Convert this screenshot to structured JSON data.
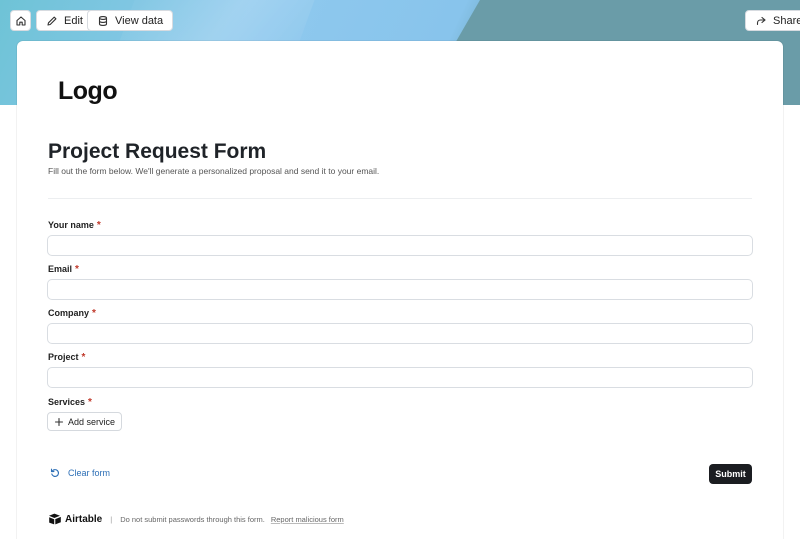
{
  "toolbar": {
    "home_icon": "home-icon",
    "edit_label": "Edit",
    "edit_icon": "pencil-icon",
    "view_data_label": "View data",
    "view_data_icon": "database-icon",
    "share_label": "Share",
    "share_icon": "share-icon"
  },
  "logo": {
    "text": "Logo"
  },
  "form": {
    "title": "Project Request Form",
    "description": "Fill out the form below. We'll generate a personalized proposal and send it to your email.",
    "required_marker": "*",
    "fields": [
      {
        "label": "Your name",
        "value": "",
        "placeholder": ""
      },
      {
        "label": "Email",
        "value": "",
        "placeholder": ""
      },
      {
        "label": "Company",
        "value": "",
        "placeholder": ""
      },
      {
        "label": "Project",
        "value": "",
        "placeholder": ""
      }
    ],
    "services": {
      "label": "Services",
      "add_label": "Add service",
      "add_icon": "plus-icon"
    },
    "clear_label": "Clear form",
    "clear_icon": "undo-icon",
    "submit_label": "Submit"
  },
  "footer": {
    "brand": "Airtable",
    "brand_icon": "airtable-logo-icon",
    "separator": "|",
    "notice": "Do not submit passwords through this form.",
    "report_link": "Report malicious form"
  },
  "colors": {
    "accent_link": "#2d6fb6",
    "required": "#c0392b",
    "submit_bg": "#1b1d21"
  }
}
